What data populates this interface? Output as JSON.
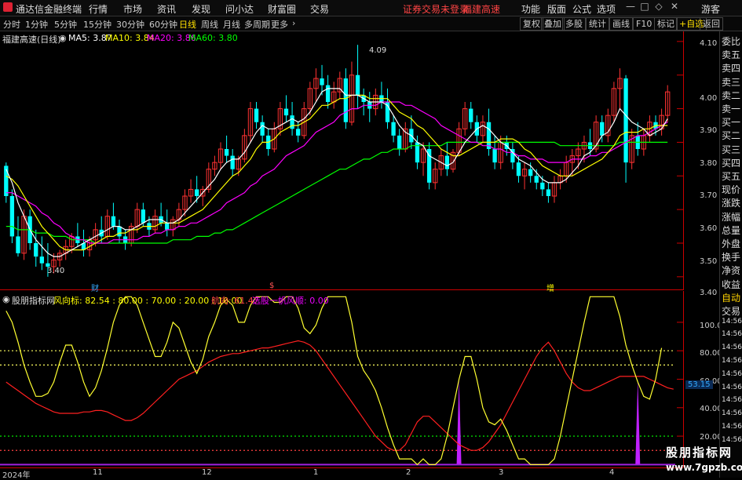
{
  "window": {
    "app_name": "通达信金融终端",
    "guest_label": "游客",
    "notice1": "证券交易未登录",
    "notice2": "福建高速"
  },
  "menus": [
    "行情",
    "市场",
    "资讯",
    "发现",
    "问小达",
    "财富圈",
    "交易"
  ],
  "right_menus": [
    "功能",
    "版面",
    "公式",
    "选项"
  ],
  "periods": [
    "分时",
    "1分钟",
    "5分钟",
    "15分钟",
    "30分钟",
    "60分钟",
    "日线",
    "周线",
    "月线",
    "多周期",
    "更多"
  ],
  "active_period": "日线",
  "toolbar_right": [
    "复权",
    "叠加",
    "多股",
    "统计",
    "画线",
    "F10",
    "标记",
    "+自选",
    "返回"
  ],
  "price_panel": {
    "stock_title": "福建高速(日线)",
    "ma5": "MA5: 3.87",
    "ma10": "MA10: 3.84",
    "ma20": "MA20: 3.86",
    "ma60": "MA60: 3.80",
    "high_label": "4.09",
    "low_label": "3.40",
    "event_marks": [
      "财",
      "$",
      "增"
    ]
  },
  "price_axis": [
    "4.10",
    "4.00",
    "3.90",
    "3.80",
    "3.70",
    "3.60",
    "3.50",
    "3.40"
  ],
  "indicator_panel": {
    "name": "股朋指标网",
    "fxb": "风向标: 82.54 : 80.00 : 70.00 : 20.00 : 10.00",
    "hangxiang": "航向: 61.47",
    "xuangu": "选股一帆风顺: 0.00",
    "current_tag": "53.15"
  },
  "ind_axis": [
    "100.0",
    "80.00",
    "60.00",
    "40.00",
    "20.00"
  ],
  "date_axis": [
    "2024年",
    "11",
    "12",
    "1",
    "2",
    "3",
    "4"
  ],
  "side_tabs": [
    "委比",
    "卖五",
    "卖四",
    "卖三",
    "卖二",
    "卖一",
    "买一",
    "买二",
    "买三",
    "买四",
    "买五",
    "现价",
    "涨跌",
    "涨幅",
    "总量",
    "外盘",
    "换手",
    "净资",
    "收益",
    "自动",
    "交易",
    "14:56",
    "14:56",
    "14:56",
    "14:56",
    "14:56",
    "14:56",
    "14:56",
    "14:56",
    "14:56",
    "14:56"
  ],
  "watermark_cn": "股朋指标网",
  "watermark_url": "www.7gpzb.com",
  "colors": {
    "up": "#ff3232",
    "down": "#00ffff",
    "ma5": "#ffffff",
    "ma10": "#ffff00",
    "ma20": "#ff00ff",
    "ma60": "#00ff00"
  },
  "candles": [
    [
      3.73,
      3.74,
      3.62,
      3.64
    ],
    [
      3.64,
      3.66,
      3.5,
      3.52
    ],
    [
      3.52,
      3.58,
      3.46,
      3.47
    ],
    [
      3.47,
      3.6,
      3.45,
      3.58
    ],
    [
      3.58,
      3.6,
      3.48,
      3.5
    ],
    [
      3.5,
      3.54,
      3.43,
      3.46
    ],
    [
      3.46,
      3.52,
      3.42,
      3.44
    ],
    [
      3.44,
      3.5,
      3.4,
      3.43
    ],
    [
      3.43,
      3.47,
      3.41,
      3.45
    ],
    [
      3.45,
      3.48,
      3.43,
      3.47
    ],
    [
      3.47,
      3.51,
      3.45,
      3.49
    ],
    [
      3.49,
      3.53,
      3.47,
      3.52
    ],
    [
      3.52,
      3.56,
      3.49,
      3.5
    ],
    [
      3.5,
      3.54,
      3.46,
      3.48
    ],
    [
      3.48,
      3.52,
      3.46,
      3.51
    ],
    [
      3.51,
      3.56,
      3.49,
      3.54
    ],
    [
      3.54,
      3.58,
      3.5,
      3.52
    ],
    [
      3.52,
      3.6,
      3.51,
      3.58
    ],
    [
      3.58,
      3.62,
      3.54,
      3.55
    ],
    [
      3.55,
      3.57,
      3.5,
      3.52
    ],
    [
      3.52,
      3.54,
      3.48,
      3.5
    ],
    [
      3.5,
      3.56,
      3.49,
      3.55
    ],
    [
      3.55,
      3.62,
      3.53,
      3.6
    ],
    [
      3.6,
      3.62,
      3.55,
      3.56
    ],
    [
      3.56,
      3.58,
      3.52,
      3.54
    ],
    [
      3.54,
      3.6,
      3.53,
      3.58
    ],
    [
      3.58,
      3.62,
      3.55,
      3.56
    ],
    [
      3.56,
      3.6,
      3.52,
      3.54
    ],
    [
      3.54,
      3.58,
      3.52,
      3.57
    ],
    [
      3.57,
      3.62,
      3.55,
      3.6
    ],
    [
      3.6,
      3.66,
      3.58,
      3.64
    ],
    [
      3.64,
      3.69,
      3.62,
      3.66
    ],
    [
      3.66,
      3.7,
      3.62,
      3.64
    ],
    [
      3.64,
      3.67,
      3.61,
      3.66
    ],
    [
      3.66,
      3.74,
      3.65,
      3.72
    ],
    [
      3.72,
      3.76,
      3.7,
      3.74
    ],
    [
      3.74,
      3.8,
      3.72,
      3.78
    ],
    [
      3.78,
      3.82,
      3.74,
      3.76
    ],
    [
      3.76,
      3.78,
      3.7,
      3.72
    ],
    [
      3.72,
      3.76,
      3.7,
      3.75
    ],
    [
      3.75,
      3.84,
      3.74,
      3.82
    ],
    [
      3.82,
      3.92,
      3.8,
      3.9
    ],
    [
      3.9,
      3.92,
      3.84,
      3.86
    ],
    [
      3.86,
      3.88,
      3.8,
      3.82
    ],
    [
      3.82,
      3.84,
      3.76,
      3.78
    ],
    [
      3.78,
      3.86,
      3.77,
      3.84
    ],
    [
      3.84,
      3.92,
      3.82,
      3.9
    ],
    [
      3.9,
      3.94,
      3.86,
      3.88
    ],
    [
      3.88,
      3.92,
      3.82,
      3.84
    ],
    [
      3.84,
      3.86,
      3.8,
      3.82
    ],
    [
      3.82,
      3.92,
      3.81,
      3.9
    ],
    [
      3.9,
      3.98,
      3.88,
      3.96
    ],
    [
      3.96,
      4.02,
      3.92,
      3.99
    ],
    [
      3.99,
      4.03,
      3.94,
      3.97
    ],
    [
      3.97,
      4.0,
      3.9,
      3.92
    ],
    [
      3.92,
      3.98,
      3.9,
      3.95
    ],
    [
      3.95,
      4.01,
      3.93,
      3.99
    ],
    [
      3.99,
      4.02,
      3.84,
      3.86
    ],
    [
      3.86,
      4.04,
      3.85,
      4.0
    ],
    [
      4.0,
      4.09,
      3.9,
      3.94
    ],
    [
      3.94,
      3.96,
      3.88,
      3.92
    ],
    [
      3.92,
      3.95,
      3.86,
      3.9
    ],
    [
      3.9,
      3.96,
      3.88,
      3.94
    ],
    [
      3.94,
      3.98,
      3.9,
      3.92
    ],
    [
      3.92,
      3.96,
      3.84,
      3.86
    ],
    [
      3.86,
      3.88,
      3.8,
      3.82
    ],
    [
      3.82,
      3.84,
      3.76,
      3.78
    ],
    [
      3.78,
      3.86,
      3.77,
      3.84
    ],
    [
      3.84,
      3.88,
      3.78,
      3.8
    ],
    [
      3.8,
      3.82,
      3.72,
      3.74
    ],
    [
      3.74,
      3.8,
      3.7,
      3.78
    ],
    [
      3.78,
      3.8,
      3.66,
      3.68
    ],
    [
      3.68,
      3.74,
      3.66,
      3.72
    ],
    [
      3.72,
      3.78,
      3.7,
      3.76
    ],
    [
      3.76,
      3.8,
      3.7,
      3.72
    ],
    [
      3.72,
      3.78,
      3.71,
      3.77
    ],
    [
      3.77,
      3.86,
      3.76,
      3.84
    ],
    [
      3.84,
      3.92,
      3.82,
      3.9
    ],
    [
      3.9,
      3.92,
      3.84,
      3.86
    ],
    [
      3.86,
      3.88,
      3.8,
      3.82
    ],
    [
      3.82,
      3.88,
      3.8,
      3.86
    ],
    [
      3.86,
      3.9,
      3.76,
      3.78
    ],
    [
      3.78,
      3.82,
      3.72,
      3.74
    ],
    [
      3.74,
      3.82,
      3.72,
      3.8
    ],
    [
      3.8,
      3.82,
      3.76,
      3.78
    ],
    [
      3.78,
      3.8,
      3.72,
      3.74
    ],
    [
      3.74,
      3.76,
      3.68,
      3.7
    ],
    [
      3.7,
      3.74,
      3.66,
      3.72
    ],
    [
      3.72,
      3.74,
      3.68,
      3.7
    ],
    [
      3.7,
      3.72,
      3.66,
      3.68
    ],
    [
      3.68,
      3.7,
      3.64,
      3.66
    ],
    [
      3.66,
      3.68,
      3.62,
      3.64
    ],
    [
      3.64,
      3.7,
      3.62,
      3.68
    ],
    [
      3.68,
      3.72,
      3.66,
      3.7
    ],
    [
      3.7,
      3.76,
      3.68,
      3.74
    ],
    [
      3.74,
      3.78,
      3.7,
      3.76
    ],
    [
      3.76,
      3.8,
      3.72,
      3.78
    ],
    [
      3.78,
      3.82,
      3.74,
      3.8
    ],
    [
      3.8,
      3.84,
      3.76,
      3.78
    ],
    [
      3.78,
      3.88,
      3.77,
      3.86
    ],
    [
      3.86,
      3.88,
      3.8,
      3.82
    ],
    [
      3.82,
      3.9,
      3.8,
      3.88
    ],
    [
      3.88,
      3.98,
      3.86,
      3.96
    ],
    [
      3.96,
      4.02,
      3.9,
      3.99
    ],
    [
      3.99,
      4.0,
      3.68,
      3.74
    ],
    [
      3.74,
      3.84,
      3.72,
      3.82
    ],
    [
      3.82,
      3.86,
      3.76,
      3.78
    ],
    [
      3.78,
      3.84,
      3.76,
      3.82
    ],
    [
      3.82,
      3.88,
      3.8,
      3.86
    ],
    [
      3.86,
      3.88,
      3.82,
      3.84
    ],
    [
      3.84,
      3.9,
      3.82,
      3.88
    ],
    [
      3.88,
      3.97,
      3.86,
      3.95
    ]
  ],
  "ma5": [
    3.72,
    3.68,
    3.62,
    3.58,
    3.54,
    3.51,
    3.49,
    3.47,
    3.46,
    3.46,
    3.47,
    3.48,
    3.49,
    3.5,
    3.51,
    3.52,
    3.53,
    3.54,
    3.55,
    3.55,
    3.54,
    3.54,
    3.55,
    3.56,
    3.57,
    3.57,
    3.57,
    3.56,
    3.56,
    3.57,
    3.59,
    3.61,
    3.63,
    3.65,
    3.67,
    3.69,
    3.72,
    3.74,
    3.75,
    3.75,
    3.77,
    3.8,
    3.83,
    3.85,
    3.84,
    3.84,
    3.85,
    3.86,
    3.87,
    3.86,
    3.87,
    3.89,
    3.92,
    3.95,
    3.96,
    3.96,
    3.96,
    3.94,
    3.94,
    3.94,
    3.93,
    3.92,
    3.92,
    3.92,
    3.91,
    3.88,
    3.85,
    3.83,
    3.82,
    3.8,
    3.79,
    3.76,
    3.75,
    3.74,
    3.73,
    3.74,
    3.77,
    3.8,
    3.82,
    3.84,
    3.85,
    3.84,
    3.82,
    3.8,
    3.79,
    3.77,
    3.75,
    3.74,
    3.73,
    3.71,
    3.69,
    3.68,
    3.68,
    3.68,
    3.69,
    3.71,
    3.73,
    3.76,
    3.77,
    3.79,
    3.82,
    3.83,
    3.86,
    3.9,
    3.88,
    3.86,
    3.85,
    3.84,
    3.82,
    3.83,
    3.84,
    3.87
  ],
  "ma10": [
    3.7,
    3.69,
    3.67,
    3.64,
    3.61,
    3.58,
    3.55,
    3.53,
    3.51,
    3.49,
    3.48,
    3.48,
    3.48,
    3.48,
    3.49,
    3.5,
    3.51,
    3.52,
    3.52,
    3.53,
    3.53,
    3.54,
    3.54,
    3.55,
    3.55,
    3.55,
    3.56,
    3.56,
    3.56,
    3.56,
    3.57,
    3.58,
    3.59,
    3.6,
    3.62,
    3.64,
    3.66,
    3.68,
    3.7,
    3.71,
    3.73,
    3.75,
    3.78,
    3.8,
    3.8,
    3.81,
    3.83,
    3.84,
    3.85,
    3.85,
    3.86,
    3.87,
    3.89,
    3.91,
    3.91,
    3.92,
    3.93,
    3.93,
    3.94,
    3.94,
    3.94,
    3.93,
    3.93,
    3.93,
    3.93,
    3.91,
    3.89,
    3.88,
    3.87,
    3.85,
    3.84,
    3.82,
    3.8,
    3.78,
    3.77,
    3.76,
    3.76,
    3.77,
    3.78,
    3.79,
    3.8,
    3.8,
    3.8,
    3.81,
    3.81,
    3.81,
    3.8,
    3.78,
    3.77,
    3.75,
    3.73,
    3.72,
    3.71,
    3.7,
    3.7,
    3.7,
    3.71,
    3.72,
    3.73,
    3.74,
    3.75,
    3.77,
    3.79,
    3.82,
    3.83,
    3.83,
    3.83,
    3.84,
    3.84,
    3.85,
    3.85,
    3.85
  ],
  "ma20": [
    3.65,
    3.65,
    3.64,
    3.63,
    3.62,
    3.61,
    3.59,
    3.58,
    3.56,
    3.55,
    3.53,
    3.52,
    3.51,
    3.51,
    3.5,
    3.5,
    3.5,
    3.5,
    3.51,
    3.51,
    3.51,
    3.51,
    3.51,
    3.52,
    3.52,
    3.53,
    3.53,
    3.54,
    3.54,
    3.55,
    3.55,
    3.56,
    3.56,
    3.57,
    3.58,
    3.59,
    3.6,
    3.62,
    3.63,
    3.64,
    3.65,
    3.67,
    3.68,
    3.7,
    3.71,
    3.72,
    3.74,
    3.76,
    3.77,
    3.78,
    3.79,
    3.81,
    3.83,
    3.84,
    3.85,
    3.86,
    3.88,
    3.89,
    3.9,
    3.9,
    3.91,
    3.91,
    3.91,
    3.92,
    3.92,
    3.92,
    3.92,
    3.91,
    3.91,
    3.9,
    3.89,
    3.88,
    3.87,
    3.85,
    3.84,
    3.83,
    3.82,
    3.81,
    3.8,
    3.8,
    3.79,
    3.79,
    3.78,
    3.78,
    3.77,
    3.77,
    3.76,
    3.76,
    3.75,
    3.75,
    3.75,
    3.74,
    3.74,
    3.74,
    3.74,
    3.75,
    3.75,
    3.75,
    3.76,
    3.76,
    3.77,
    3.77,
    3.78,
    3.79,
    3.8,
    3.81,
    3.82,
    3.82,
    3.83,
    3.84,
    3.85,
    3.86
  ],
  "ma60": [
    3.55,
    3.55,
    3.54,
    3.54,
    3.54,
    3.53,
    3.53,
    3.53,
    3.52,
    3.52,
    3.52,
    3.51,
    3.51,
    3.51,
    3.51,
    3.5,
    3.5,
    3.5,
    3.5,
    3.5,
    3.5,
    3.5,
    3.5,
    3.5,
    3.5,
    3.5,
    3.5,
    3.5,
    3.51,
    3.51,
    3.51,
    3.51,
    3.52,
    3.52,
    3.52,
    3.53,
    3.53,
    3.54,
    3.54,
    3.55,
    3.56,
    3.57,
    3.58,
    3.59,
    3.6,
    3.61,
    3.62,
    3.63,
    3.64,
    3.65,
    3.66,
    3.67,
    3.68,
    3.69,
    3.7,
    3.71,
    3.72,
    3.72,
    3.73,
    3.74,
    3.75,
    3.75,
    3.76,
    3.77,
    3.77,
    3.78,
    3.78,
    3.78,
    3.79,
    3.79,
    3.79,
    3.79,
    3.79,
    3.79,
    3.8,
    3.8,
    3.8,
    3.8,
    3.8,
    3.8,
    3.8,
    3.8,
    3.8,
    3.8,
    3.8,
    3.8,
    3.8,
    3.8,
    3.8,
    3.8,
    3.8,
    3.8,
    3.8,
    3.79,
    3.79,
    3.79,
    3.79,
    3.79,
    3.79,
    3.79,
    3.79,
    3.79,
    3.79,
    3.8,
    3.8,
    3.8,
    3.8,
    3.8,
    3.8,
    3.8,
    3.8,
    3.8
  ],
  "yellow_line": [
    108,
    100,
    86,
    70,
    58,
    48,
    48,
    50,
    58,
    72,
    84,
    84,
    72,
    58,
    48,
    54,
    66,
    82,
    100,
    112,
    118,
    118,
    112,
    100,
    88,
    76,
    76,
    86,
    100,
    96,
    84,
    72,
    64,
    74,
    90,
    100,
    112,
    116,
    112,
    100,
    100,
    112,
    118,
    118,
    118,
    114,
    114,
    118,
    118,
    110,
    96,
    92,
    98,
    110,
    118,
    118,
    118,
    118,
    100,
    76,
    66,
    60,
    52,
    40,
    26,
    14,
    4,
    4,
    4,
    0,
    4,
    0,
    0,
    4,
    20,
    40,
    60,
    76,
    76,
    60,
    40,
    30,
    28,
    32,
    24,
    14,
    4,
    4,
    0,
    0,
    0,
    0,
    4,
    20,
    40,
    60,
    80,
    100,
    118,
    118,
    118,
    118,
    118,
    104,
    84,
    70,
    58,
    48,
    46,
    60,
    82
  ],
  "red_line": [
    58,
    55,
    52,
    49,
    46,
    43,
    41,
    39,
    37,
    36,
    36,
    36,
    36,
    37,
    37,
    38,
    38,
    37,
    35,
    33,
    31,
    31,
    33,
    36,
    40,
    44,
    48,
    52,
    56,
    60,
    62,
    64,
    66,
    69,
    72,
    74,
    76,
    77,
    78,
    78,
    79,
    80,
    81,
    82,
    82,
    83,
    84,
    85,
    86,
    87,
    86,
    84,
    80,
    74,
    68,
    62,
    56,
    50,
    44,
    38,
    32,
    26,
    20,
    16,
    12,
    10,
    10,
    14,
    22,
    30,
    34,
    34,
    30,
    26,
    22,
    18,
    14,
    12,
    10,
    10,
    12,
    16,
    22,
    28,
    36,
    44,
    52,
    60,
    68,
    76,
    82,
    86,
    80,
    72,
    64,
    58,
    54,
    52,
    52,
    54,
    56,
    58,
    60,
    62,
    62,
    62,
    62,
    62,
    60,
    58,
    56,
    54,
    53
  ],
  "purple_spikes": [
    {
      "i": 76,
      "v": 60
    },
    {
      "i": 106,
      "v": 60
    }
  ]
}
